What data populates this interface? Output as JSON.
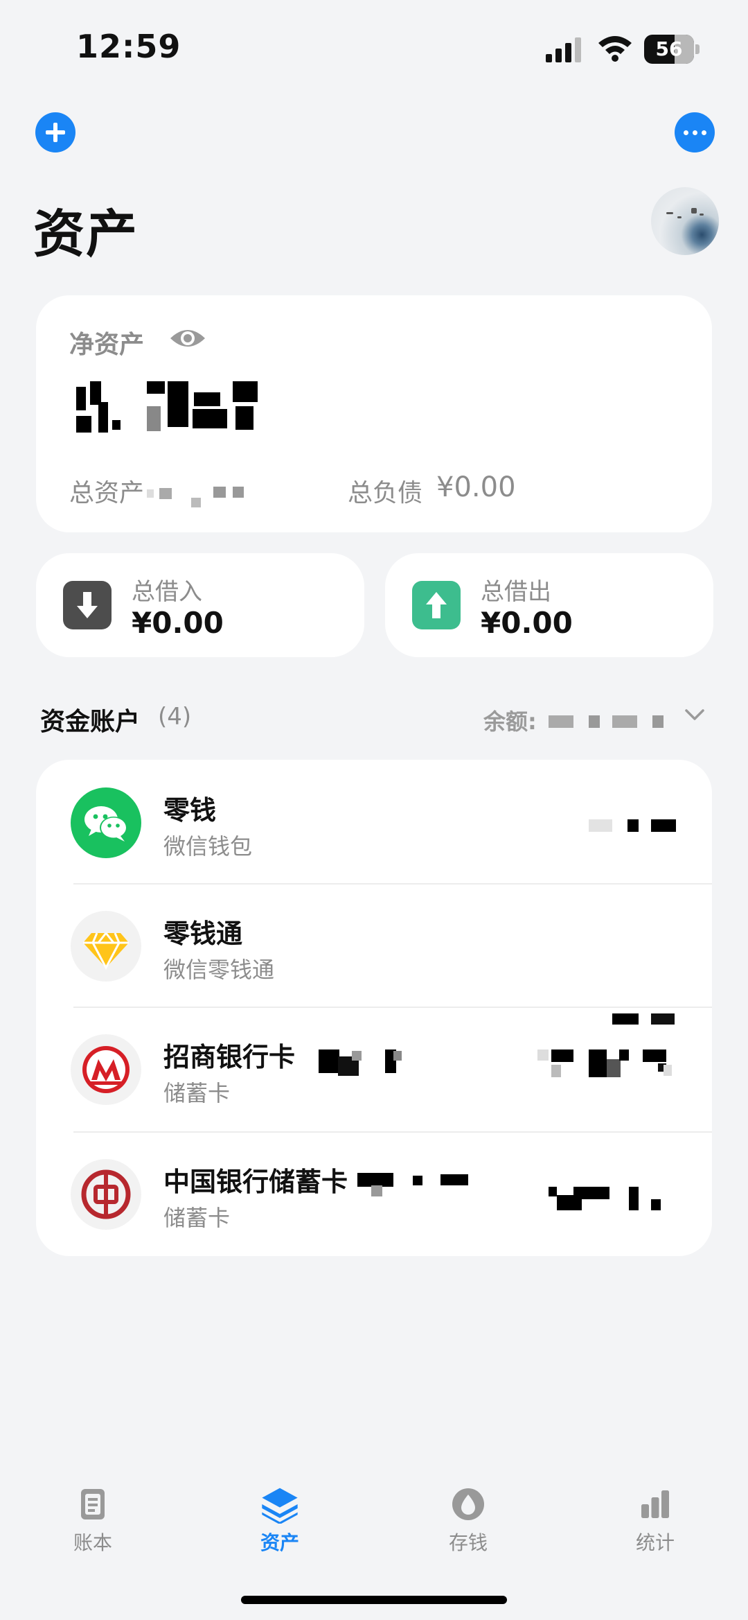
{
  "status_bar": {
    "time": "12:59",
    "battery": "56"
  },
  "header": {
    "title": "资产"
  },
  "net_assets": {
    "label": "净资产",
    "total_assets_label": "总资产",
    "total_liabilities_label": "总负债",
    "total_liabilities_value": "¥0.00"
  },
  "loans": {
    "borrow": {
      "label": "总借入",
      "value": "¥0.00"
    },
    "lend": {
      "label": "总借出",
      "value": "¥0.00"
    }
  },
  "accounts_section": {
    "title": "资金账户",
    "count": "(4)",
    "balance_label": "余额:"
  },
  "accounts": [
    {
      "name": "零钱",
      "subtitle": "微信钱包",
      "icon": "wechat-icon"
    },
    {
      "name": "零钱通",
      "subtitle": "微信零钱通",
      "icon": "diamond-icon"
    },
    {
      "name": "招商银行卡",
      "subtitle": "储蓄卡",
      "icon": "cmb-logo-icon"
    },
    {
      "name": "中国银行储蓄卡",
      "subtitle": "储蓄卡",
      "icon": "boc-logo-icon"
    }
  ],
  "tabs": [
    {
      "label": "账本",
      "icon": "ledger-icon",
      "active": false
    },
    {
      "label": "资产",
      "icon": "layers-icon",
      "active": true
    },
    {
      "label": "存钱",
      "icon": "drop-icon",
      "active": false
    },
    {
      "label": "统计",
      "icon": "bar-chart-icon",
      "active": false
    }
  ],
  "colors": {
    "accent": "#1a85f5",
    "lend_green": "#3dbd8e",
    "borrow_gray": "#4d4d4d",
    "background": "#f3f4f6"
  }
}
